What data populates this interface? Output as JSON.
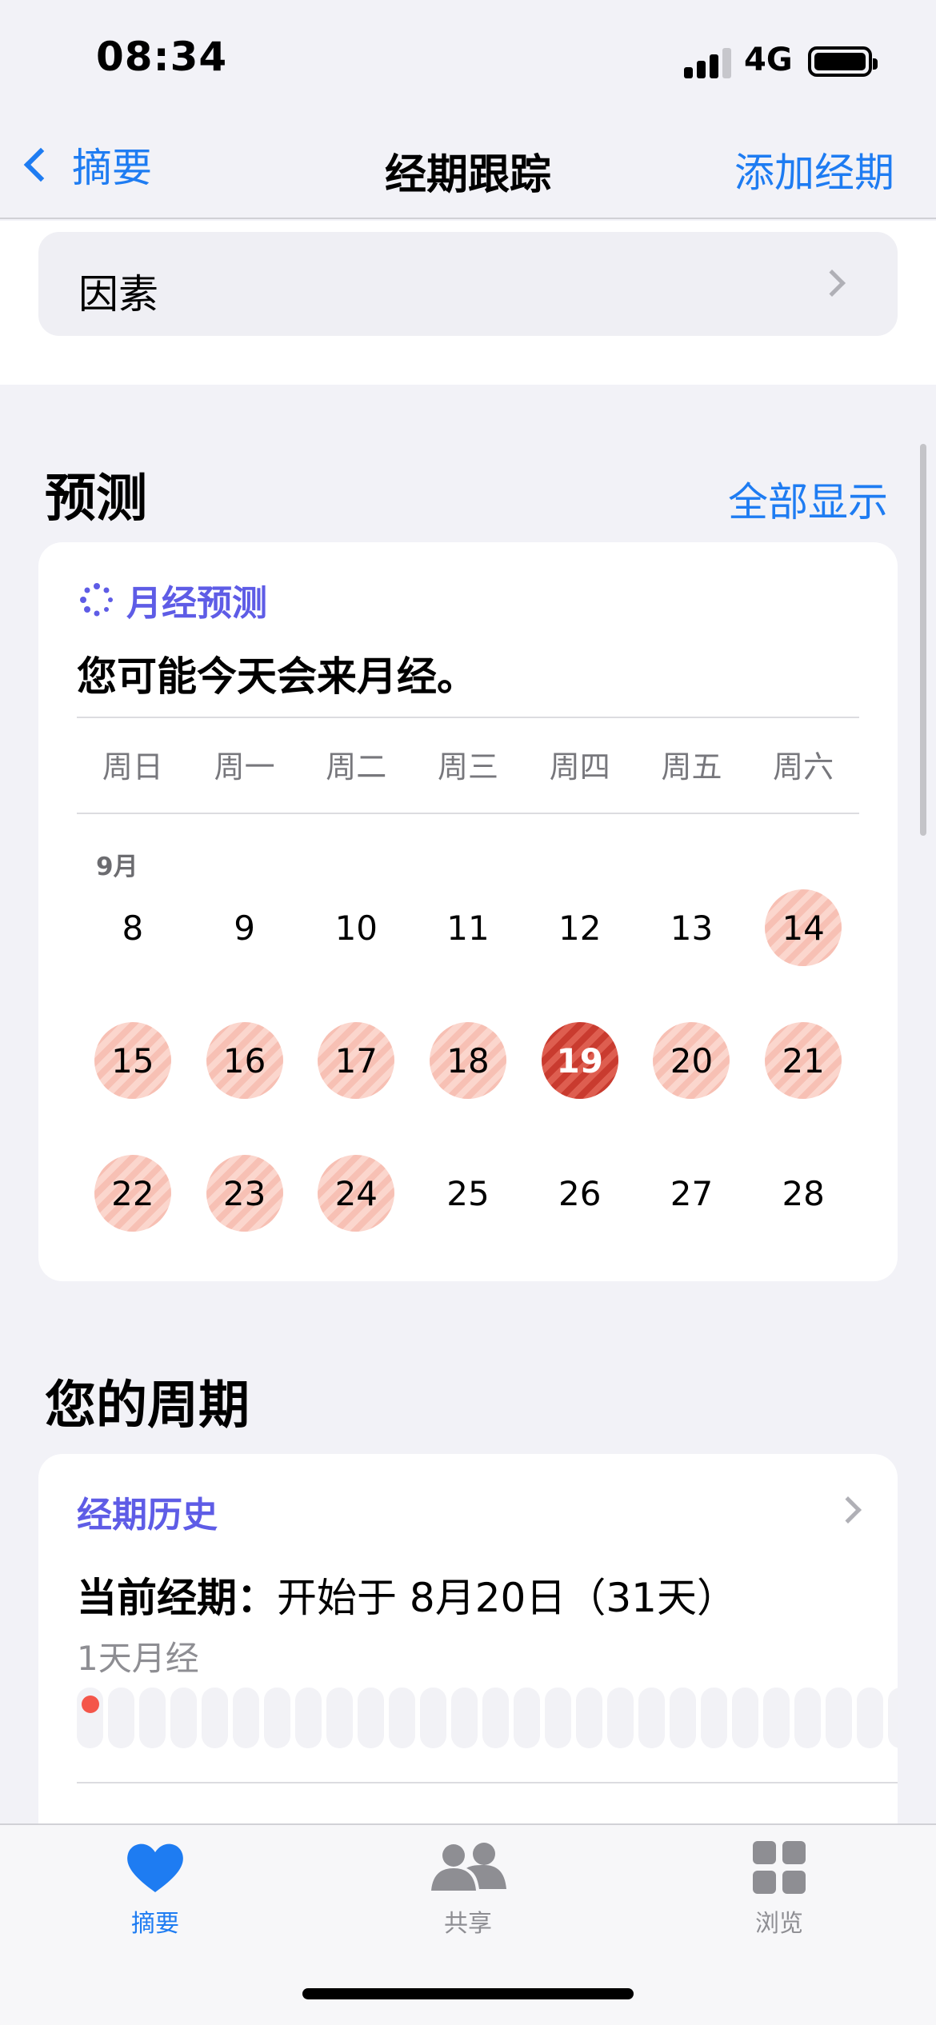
{
  "status_bar": {
    "time": "08:34",
    "network": "4G"
  },
  "nav": {
    "back_label": "摘要",
    "title": "经期跟踪",
    "action_label": "添加经期"
  },
  "factors": {
    "label": "因素"
  },
  "prediction": {
    "section_title": "预测",
    "show_all": "全部显示",
    "card_title": "月经预测",
    "message": "您可能今天会来月经。",
    "weekdays": [
      "周日",
      "周一",
      "周二",
      "周三",
      "周四",
      "周五",
      "周六"
    ],
    "month_label": "9月",
    "weeks": [
      [
        {
          "d": "8",
          "s": ""
        },
        {
          "d": "9",
          "s": ""
        },
        {
          "d": "10",
          "s": ""
        },
        {
          "d": "11",
          "s": ""
        },
        {
          "d": "12",
          "s": ""
        },
        {
          "d": "13",
          "s": ""
        },
        {
          "d": "14",
          "s": "pred"
        }
      ],
      [
        {
          "d": "15",
          "s": "pred"
        },
        {
          "d": "16",
          "s": "pred"
        },
        {
          "d": "17",
          "s": "pred"
        },
        {
          "d": "18",
          "s": "pred"
        },
        {
          "d": "19",
          "s": "today"
        },
        {
          "d": "20",
          "s": "pred"
        },
        {
          "d": "21",
          "s": "pred"
        }
      ],
      [
        {
          "d": "22",
          "s": "pred"
        },
        {
          "d": "23",
          "s": "pred"
        },
        {
          "d": "24",
          "s": "pred"
        },
        {
          "d": "25",
          "s": ""
        },
        {
          "d": "26",
          "s": ""
        },
        {
          "d": "27",
          "s": ""
        },
        {
          "d": "28",
          "s": ""
        }
      ]
    ]
  },
  "cycle": {
    "section_title": "您的周期",
    "history_title": "经期历史",
    "current_label": "当前经期：",
    "current_value": "开始于 8月20日（31天）",
    "period_length": "1天月经",
    "logged_days": 1,
    "total_days": 31
  },
  "tabbar": {
    "items": [
      {
        "label": "摘要",
        "icon": "heart-icon",
        "active": true
      },
      {
        "label": "共享",
        "icon": "people-icon",
        "active": false
      },
      {
        "label": "浏览",
        "icon": "grid-icon",
        "active": false
      }
    ]
  },
  "colors": {
    "accent": "#1e7cf2",
    "purple": "#5e5ce6",
    "period_red": "#f4564a",
    "predicted": "#f7c0b4"
  }
}
